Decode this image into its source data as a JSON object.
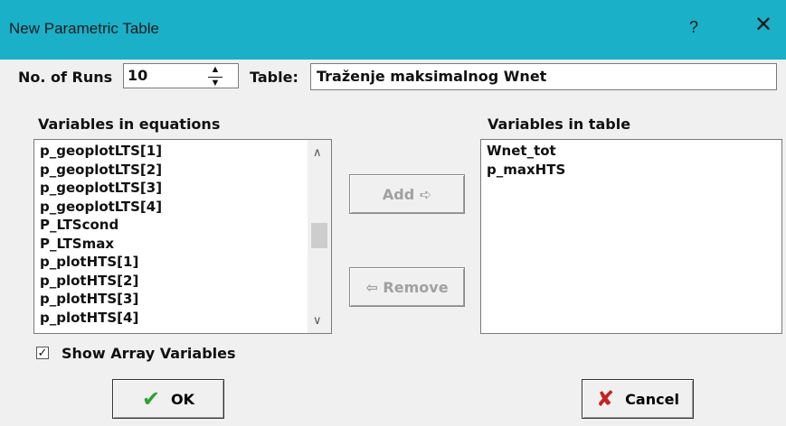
{
  "window": {
    "title": "New Parametric Table",
    "help_label": "?",
    "close_label": "✕"
  },
  "runs": {
    "label": "No. of Runs",
    "value": "10"
  },
  "table": {
    "label": "Table:",
    "value": "Traženje maksimalnog Wnet"
  },
  "equations": {
    "label": "Variables in equations",
    "items": [
      "p_geoplotLTS[1]",
      "p_geoplotLTS[2]",
      "p_geoplotLTS[3]",
      "p_geoplotLTS[4]",
      "P_LTScond",
      "P_LTSmax",
      "p_plotHTS[1]",
      "p_plotHTS[2]",
      "p_plotHTS[3]",
      "p_plotHTS[4]"
    ]
  },
  "table_vars": {
    "label": "Variables in table",
    "items": [
      "Wnet_tot",
      "p_maxHTS"
    ]
  },
  "buttons": {
    "add_label": "Add ➪",
    "remove_label": "⇦ Remove",
    "ok_label": "OK",
    "cancel_label": "Cancel"
  },
  "show_array": {
    "label": "Show Array Variables",
    "checked": true
  },
  "icons": {
    "ok": "check-icon",
    "cancel": "x-icon",
    "spinner": "up-down-spinner-icon"
  },
  "colors": {
    "titlebar": "#1ab0c8",
    "dialog_bg": "#f0f0f0",
    "ok_check": "#2ea12e",
    "cancel_x": "#c42222",
    "disabled_text": "#a0a0a0"
  }
}
